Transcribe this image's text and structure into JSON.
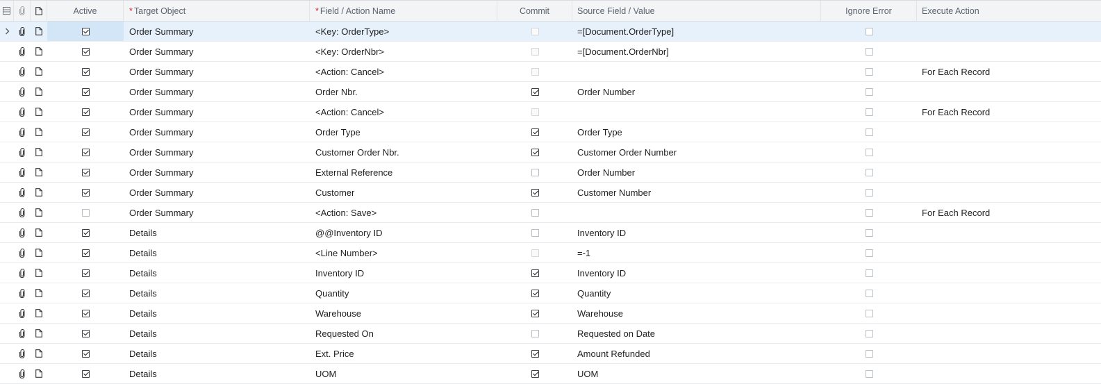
{
  "columns": {
    "active": "Active",
    "target_object": "Target Object",
    "field_action": "Field / Action Name",
    "commit": "Commit",
    "source_value": "Source Field / Value",
    "ignore_error": "Ignore Error",
    "execute_action": "Execute Action"
  },
  "required_marker": "*",
  "selected_row": 0,
  "rows": [
    {
      "active": true,
      "target": "Order Summary",
      "field": "<Key: OrderType>",
      "commit": false,
      "commit_disabled": true,
      "source": "=[Document.OrderType]",
      "ignore": false,
      "execute": ""
    },
    {
      "active": true,
      "target": "Order Summary",
      "field": "<Key: OrderNbr>",
      "commit": false,
      "commit_disabled": true,
      "source": "=[Document.OrderNbr]",
      "ignore": false,
      "execute": ""
    },
    {
      "active": true,
      "target": "Order Summary",
      "field": "<Action: Cancel>",
      "commit": false,
      "commit_disabled": true,
      "source": "",
      "ignore": false,
      "execute": "For Each Record"
    },
    {
      "active": true,
      "target": "Order Summary",
      "field": "Order Nbr.",
      "commit": true,
      "commit_disabled": false,
      "source": "Order Number",
      "ignore": false,
      "execute": ""
    },
    {
      "active": true,
      "target": "Order Summary",
      "field": "<Action: Cancel>",
      "commit": false,
      "commit_disabled": true,
      "source": "",
      "ignore": false,
      "execute": "For Each Record"
    },
    {
      "active": true,
      "target": "Order Summary",
      "field": "Order Type",
      "commit": true,
      "commit_disabled": false,
      "source": "Order Type",
      "ignore": false,
      "execute": ""
    },
    {
      "active": true,
      "target": "Order Summary",
      "field": "Customer Order Nbr.",
      "commit": true,
      "commit_disabled": false,
      "source": "Customer Order Number",
      "ignore": false,
      "execute": ""
    },
    {
      "active": true,
      "target": "Order Summary",
      "field": "External Reference",
      "commit": false,
      "commit_disabled": false,
      "source": "Order Number",
      "ignore": false,
      "execute": ""
    },
    {
      "active": true,
      "target": "Order Summary",
      "field": "Customer",
      "commit": true,
      "commit_disabled": false,
      "source": "Customer Number",
      "ignore": false,
      "execute": ""
    },
    {
      "active": false,
      "target": "Order Summary",
      "field": "<Action: Save>",
      "commit": false,
      "commit_disabled": false,
      "source": "",
      "ignore": false,
      "execute": "For Each Record"
    },
    {
      "active": true,
      "target": "Details",
      "field": "@@Inventory ID",
      "commit": false,
      "commit_disabled": false,
      "source": "Inventory ID",
      "ignore": false,
      "execute": ""
    },
    {
      "active": true,
      "target": "Details",
      "field": "<Line Number>",
      "commit": false,
      "commit_disabled": true,
      "source": "=-1",
      "ignore": false,
      "execute": ""
    },
    {
      "active": true,
      "target": "Details",
      "field": "Inventory ID",
      "commit": true,
      "commit_disabled": false,
      "source": "Inventory ID",
      "ignore": false,
      "execute": ""
    },
    {
      "active": true,
      "target": "Details",
      "field": "Quantity",
      "commit": true,
      "commit_disabled": false,
      "source": "Quantity",
      "ignore": false,
      "execute": ""
    },
    {
      "active": true,
      "target": "Details",
      "field": "Warehouse",
      "commit": true,
      "commit_disabled": false,
      "source": "Warehouse",
      "ignore": false,
      "execute": ""
    },
    {
      "active": true,
      "target": "Details",
      "field": "Requested On",
      "commit": false,
      "commit_disabled": false,
      "source": "Requested on Date",
      "ignore": false,
      "execute": ""
    },
    {
      "active": true,
      "target": "Details",
      "field": "Ext. Price",
      "commit": true,
      "commit_disabled": false,
      "source": "Amount Refunded",
      "ignore": false,
      "execute": ""
    },
    {
      "active": true,
      "target": "Details",
      "field": "UOM",
      "commit": true,
      "commit_disabled": false,
      "source": "UOM",
      "ignore": false,
      "execute": ""
    }
  ],
  "icons": {
    "header_col0": "row-settings-icon",
    "attachment": "paperclip-icon",
    "note": "note-icon",
    "row_selector": "chevron-right-icon"
  }
}
